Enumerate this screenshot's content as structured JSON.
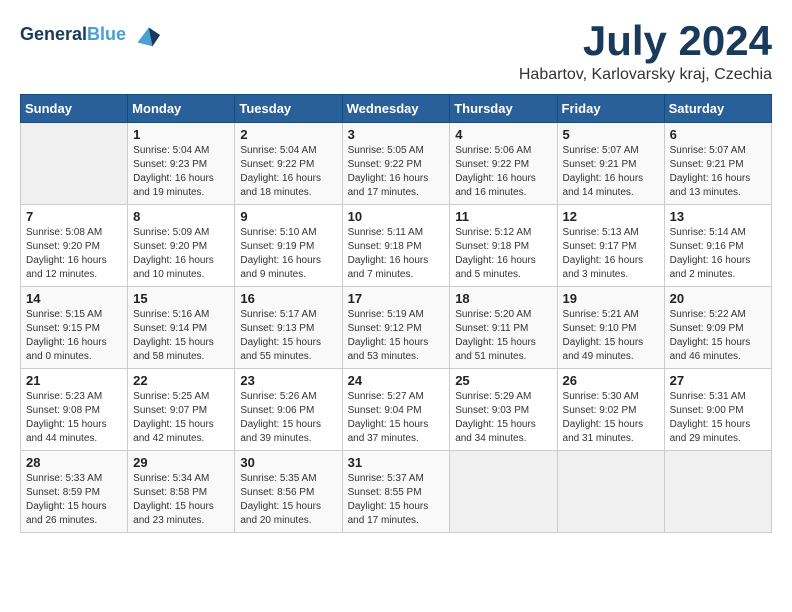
{
  "header": {
    "logo_line1": "General",
    "logo_line2": "Blue",
    "month_title": "July 2024",
    "subtitle": "Habartov, Karlovarsky kraj, Czechia"
  },
  "weekdays": [
    "Sunday",
    "Monday",
    "Tuesday",
    "Wednesday",
    "Thursday",
    "Friday",
    "Saturday"
  ],
  "weeks": [
    [
      {
        "day": "",
        "info": ""
      },
      {
        "day": "1",
        "info": "Sunrise: 5:04 AM\nSunset: 9:23 PM\nDaylight: 16 hours\nand 19 minutes."
      },
      {
        "day": "2",
        "info": "Sunrise: 5:04 AM\nSunset: 9:22 PM\nDaylight: 16 hours\nand 18 minutes."
      },
      {
        "day": "3",
        "info": "Sunrise: 5:05 AM\nSunset: 9:22 PM\nDaylight: 16 hours\nand 17 minutes."
      },
      {
        "day": "4",
        "info": "Sunrise: 5:06 AM\nSunset: 9:22 PM\nDaylight: 16 hours\nand 16 minutes."
      },
      {
        "day": "5",
        "info": "Sunrise: 5:07 AM\nSunset: 9:21 PM\nDaylight: 16 hours\nand 14 minutes."
      },
      {
        "day": "6",
        "info": "Sunrise: 5:07 AM\nSunset: 9:21 PM\nDaylight: 16 hours\nand 13 minutes."
      }
    ],
    [
      {
        "day": "7",
        "info": "Sunrise: 5:08 AM\nSunset: 9:20 PM\nDaylight: 16 hours\nand 12 minutes."
      },
      {
        "day": "8",
        "info": "Sunrise: 5:09 AM\nSunset: 9:20 PM\nDaylight: 16 hours\nand 10 minutes."
      },
      {
        "day": "9",
        "info": "Sunrise: 5:10 AM\nSunset: 9:19 PM\nDaylight: 16 hours\nand 9 minutes."
      },
      {
        "day": "10",
        "info": "Sunrise: 5:11 AM\nSunset: 9:18 PM\nDaylight: 16 hours\nand 7 minutes."
      },
      {
        "day": "11",
        "info": "Sunrise: 5:12 AM\nSunset: 9:18 PM\nDaylight: 16 hours\nand 5 minutes."
      },
      {
        "day": "12",
        "info": "Sunrise: 5:13 AM\nSunset: 9:17 PM\nDaylight: 16 hours\nand 3 minutes."
      },
      {
        "day": "13",
        "info": "Sunrise: 5:14 AM\nSunset: 9:16 PM\nDaylight: 16 hours\nand 2 minutes."
      }
    ],
    [
      {
        "day": "14",
        "info": "Sunrise: 5:15 AM\nSunset: 9:15 PM\nDaylight: 16 hours\nand 0 minutes."
      },
      {
        "day": "15",
        "info": "Sunrise: 5:16 AM\nSunset: 9:14 PM\nDaylight: 15 hours\nand 58 minutes."
      },
      {
        "day": "16",
        "info": "Sunrise: 5:17 AM\nSunset: 9:13 PM\nDaylight: 15 hours\nand 55 minutes."
      },
      {
        "day": "17",
        "info": "Sunrise: 5:19 AM\nSunset: 9:12 PM\nDaylight: 15 hours\nand 53 minutes."
      },
      {
        "day": "18",
        "info": "Sunrise: 5:20 AM\nSunset: 9:11 PM\nDaylight: 15 hours\nand 51 minutes."
      },
      {
        "day": "19",
        "info": "Sunrise: 5:21 AM\nSunset: 9:10 PM\nDaylight: 15 hours\nand 49 minutes."
      },
      {
        "day": "20",
        "info": "Sunrise: 5:22 AM\nSunset: 9:09 PM\nDaylight: 15 hours\nand 46 minutes."
      }
    ],
    [
      {
        "day": "21",
        "info": "Sunrise: 5:23 AM\nSunset: 9:08 PM\nDaylight: 15 hours\nand 44 minutes."
      },
      {
        "day": "22",
        "info": "Sunrise: 5:25 AM\nSunset: 9:07 PM\nDaylight: 15 hours\nand 42 minutes."
      },
      {
        "day": "23",
        "info": "Sunrise: 5:26 AM\nSunset: 9:06 PM\nDaylight: 15 hours\nand 39 minutes."
      },
      {
        "day": "24",
        "info": "Sunrise: 5:27 AM\nSunset: 9:04 PM\nDaylight: 15 hours\nand 37 minutes."
      },
      {
        "day": "25",
        "info": "Sunrise: 5:29 AM\nSunset: 9:03 PM\nDaylight: 15 hours\nand 34 minutes."
      },
      {
        "day": "26",
        "info": "Sunrise: 5:30 AM\nSunset: 9:02 PM\nDaylight: 15 hours\nand 31 minutes."
      },
      {
        "day": "27",
        "info": "Sunrise: 5:31 AM\nSunset: 9:00 PM\nDaylight: 15 hours\nand 29 minutes."
      }
    ],
    [
      {
        "day": "28",
        "info": "Sunrise: 5:33 AM\nSunset: 8:59 PM\nDaylight: 15 hours\nand 26 minutes."
      },
      {
        "day": "29",
        "info": "Sunrise: 5:34 AM\nSunset: 8:58 PM\nDaylight: 15 hours\nand 23 minutes."
      },
      {
        "day": "30",
        "info": "Sunrise: 5:35 AM\nSunset: 8:56 PM\nDaylight: 15 hours\nand 20 minutes."
      },
      {
        "day": "31",
        "info": "Sunrise: 5:37 AM\nSunset: 8:55 PM\nDaylight: 15 hours\nand 17 minutes."
      },
      {
        "day": "",
        "info": ""
      },
      {
        "day": "",
        "info": ""
      },
      {
        "day": "",
        "info": ""
      }
    ]
  ]
}
